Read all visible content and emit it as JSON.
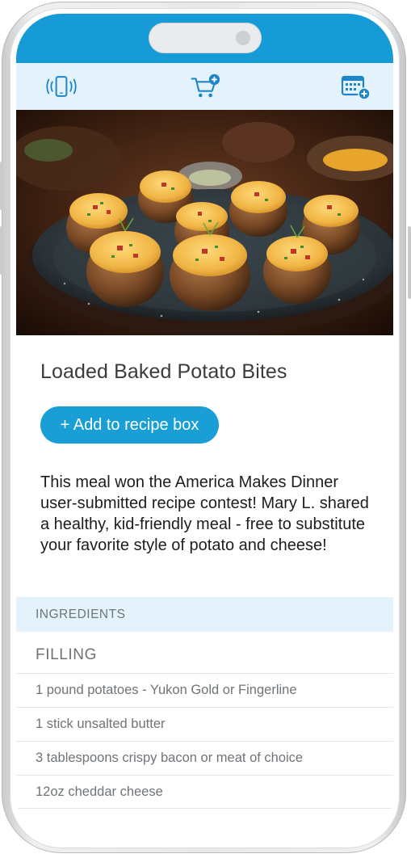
{
  "colors": {
    "brand_blue": "#179bd6",
    "toolbar_bg": "#e4f3fb",
    "button_blue": "#199ed6"
  },
  "toolbar": {
    "icons": [
      "phone-vibrate-icon",
      "cart-add-icon",
      "calendar-add-icon"
    ]
  },
  "recipe": {
    "title": "Loaded Baked Potato Bites",
    "add_button_label": "+ Add to recipe box",
    "description": "This meal won the America Makes Dinner user-submitted recipe contest! Mary L. shared a healthy, kid-friendly meal - free to substitute your favorite style of potato and cheese!"
  },
  "ingredients": {
    "section_label": "INGREDIENTS",
    "groups": [
      {
        "name": "FILLING",
        "items": [
          "1 pound potatoes - Yukon Gold or Fingerline",
          "1 stick unsalted butter",
          "3 tablespoons crispy bacon or meat of choice",
          "12oz cheddar cheese"
        ]
      }
    ]
  }
}
